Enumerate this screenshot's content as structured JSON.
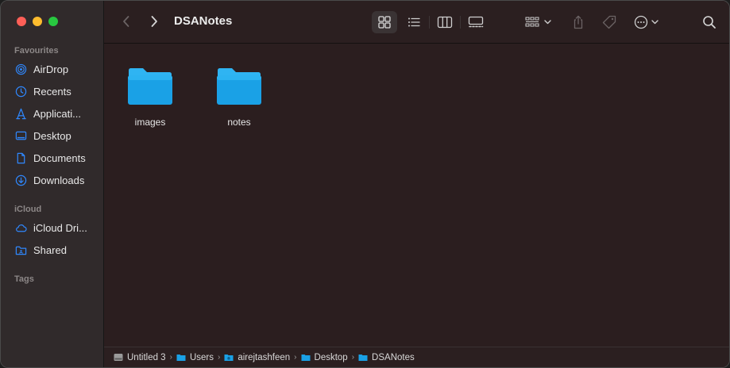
{
  "window": {
    "title": "DSANotes"
  },
  "sidebar": {
    "favourites_title": "Favourites",
    "favourites": [
      {
        "label": "AirDrop",
        "icon": "airdrop-icon"
      },
      {
        "label": "Recents",
        "icon": "clock-icon"
      },
      {
        "label": "Applicati...",
        "icon": "applications-icon"
      },
      {
        "label": "Desktop",
        "icon": "desktop-icon"
      },
      {
        "label": "Documents",
        "icon": "document-icon"
      },
      {
        "label": "Downloads",
        "icon": "download-icon"
      }
    ],
    "icloud_title": "iCloud",
    "icloud": [
      {
        "label": "iCloud Dri...",
        "icon": "cloud-icon"
      },
      {
        "label": "Shared",
        "icon": "shared-folder-icon"
      }
    ],
    "tags_title": "Tags"
  },
  "files": [
    {
      "name": "images",
      "icon": "folder-icon"
    },
    {
      "name": "notes",
      "icon": "folder-icon"
    }
  ],
  "pathbar": [
    {
      "label": "Untitled 3",
      "icon": "disk-icon"
    },
    {
      "label": "Users",
      "icon": "folder-icon"
    },
    {
      "label": "airejtashfeen",
      "icon": "home-folder-icon"
    },
    {
      "label": "Desktop",
      "icon": "folder-icon"
    },
    {
      "label": "DSANotes",
      "icon": "folder-icon"
    }
  ],
  "colors": {
    "accent": "#2f88ff",
    "folder_top": "#2fb4f2",
    "folder_body": "#1aa1e6",
    "window_bg": "#2b1e1f",
    "sidebar_bg": "#302a2b"
  }
}
